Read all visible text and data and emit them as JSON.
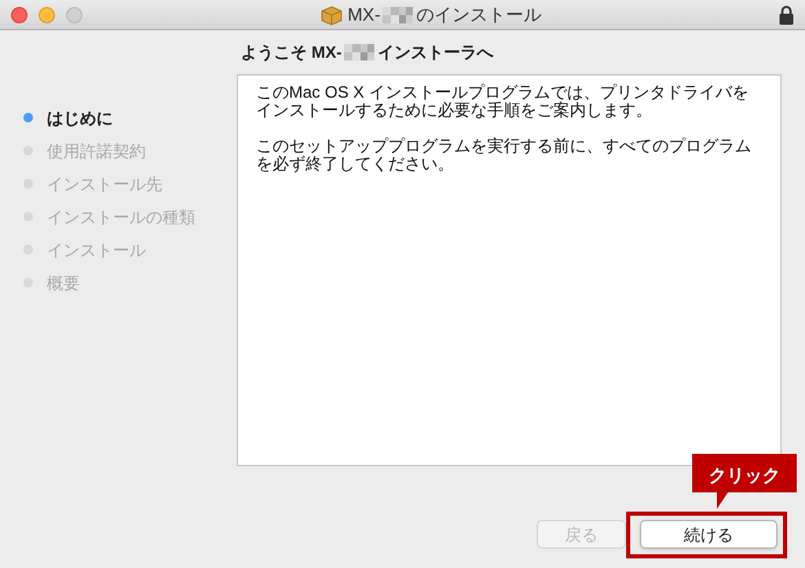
{
  "window": {
    "title_prefix": "MX-",
    "title_suffix": "のインストール"
  },
  "heading": {
    "prefix": "ようこそ MX-",
    "suffix": "インストーラへ"
  },
  "steps": [
    {
      "label": "はじめに",
      "selected": true
    },
    {
      "label": "使用許諾契約",
      "selected": false
    },
    {
      "label": "インストール先",
      "selected": false
    },
    {
      "label": "インストールの種類",
      "selected": false
    },
    {
      "label": "インストール",
      "selected": false
    },
    {
      "label": "概要",
      "selected": false
    }
  ],
  "paragraphs": [
    "このMac OS X インストールプログラムでは、プリンタドライバをインストールするために必要な手順をご案内します。",
    "このセットアッププログラムを実行する前に、すべてのプログラムを必ず終了してください。"
  ],
  "buttons": [
    {
      "label": "戻る",
      "disabled": true
    },
    {
      "label": "続ける",
      "disabled": false
    }
  ],
  "callout": {
    "label": "クリック"
  }
}
